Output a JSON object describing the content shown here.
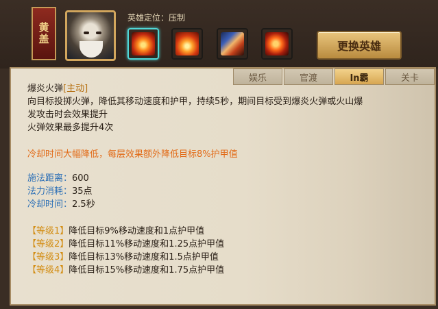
{
  "hero": {
    "name": "黄盖",
    "role_label": "英雄定位：压制"
  },
  "buttons": {
    "change_hero": "更换英雄"
  },
  "skills": [
    {
      "icon": "fire-bomb-icon",
      "selected": true
    },
    {
      "icon": "fire-burst-icon",
      "selected": false
    },
    {
      "icon": "flame-sword-icon",
      "selected": false
    },
    {
      "icon": "fire-fist-icon",
      "selected": false
    }
  ],
  "tabs": [
    {
      "label": "娱乐",
      "active": false
    },
    {
      "label": "官渡",
      "active": false
    },
    {
      "label": "In霸",
      "active": true
    },
    {
      "label": "关卡",
      "active": false
    }
  ],
  "skill_info": {
    "name": "爆炎火弹",
    "tag": "[主动]",
    "desc1": "向目标投掷火弹，降低其移动速度和护甲，持续5秒，期间目标受到爆炎火弹或火山爆",
    "desc2": "发攻击时会效果提升",
    "desc3": "火弹效果最多提升4次",
    "bonus": "冷却时间大幅降低，每层效果额外降低目标8%护甲值",
    "stats": [
      {
        "label": "施法距离：",
        "value": "600"
      },
      {
        "label": "法力消耗：",
        "value": "35点"
      },
      {
        "label": "冷却时间：",
        "value": "2.5秒"
      }
    ],
    "levels": [
      {
        "label": "【等级1】",
        "text": "降低目标9%移动速度和1点护甲值"
      },
      {
        "label": "【等级2】",
        "text": "降低目标11%移动速度和1.25点护甲值"
      },
      {
        "label": "【等级3】",
        "text": "降低目标13%移动速度和1.5点护甲值"
      },
      {
        "label": "【等级4】",
        "text": "降低目标15%移动速度和1.75点护甲值"
      }
    ]
  },
  "colors": {
    "accent_gold": "#d38d12",
    "bonus_orange": "#e26a16",
    "stat_blue": "#2b6fb6",
    "selected_cyan": "#50d7d7"
  }
}
